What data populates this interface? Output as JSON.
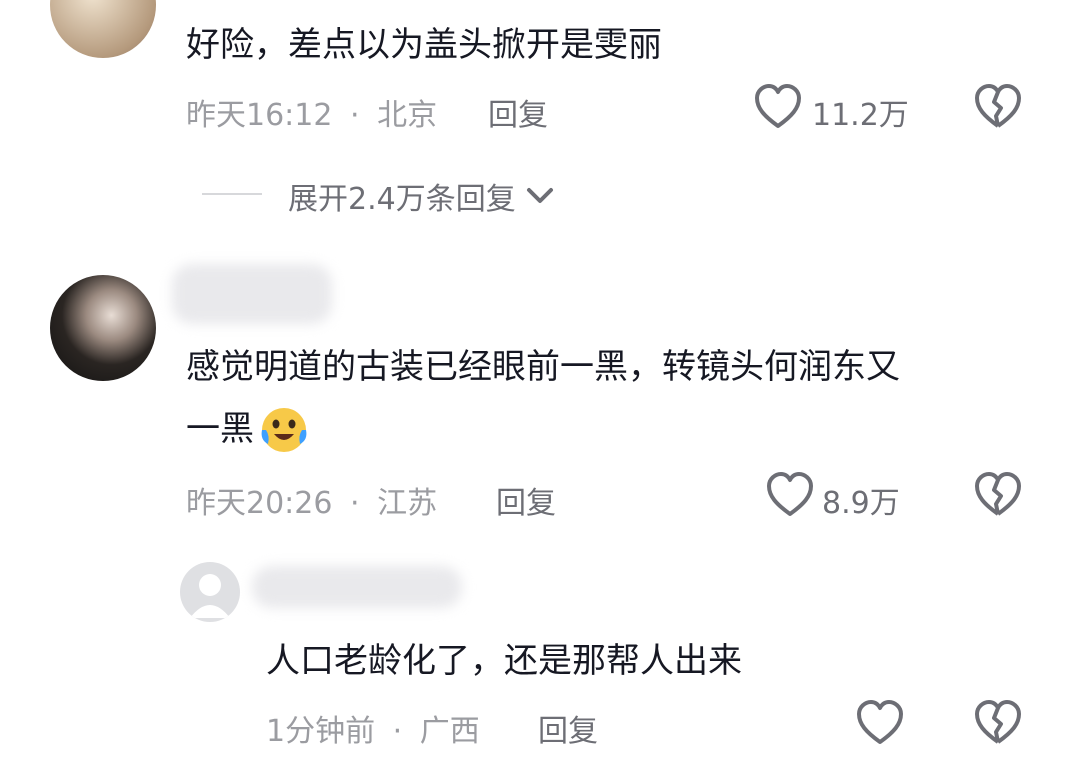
{
  "comments": [
    {
      "text": "好险，差点以为盖头掀开是雯丽",
      "time": "昨天16:12",
      "location": "北京",
      "reply_label": "回复",
      "likes": "11.2万",
      "expand_label": "展开2.4万条回复"
    },
    {
      "text_line1": "感觉明道的古装已经眼前一黑，转镜头何润东又",
      "text_line2": "一黑",
      "emoji_icon": "crying-laughing-emoji-icon",
      "time": "昨天20:26",
      "location": "江苏",
      "reply_label": "回复",
      "likes": "8.9万",
      "replies": [
        {
          "text": "人口老龄化了，还是那帮人出来",
          "time": "1分钟前",
          "location": "广西",
          "reply_label": "回复"
        }
      ]
    }
  ],
  "separator": "·",
  "icons": [
    "heart-outline-icon",
    "broken-heart-icon",
    "chevron-down-icon",
    "default-avatar-icon"
  ],
  "colors": {
    "text": "#161823",
    "meta": "#9b9ca1",
    "secondary": "#6d6e75",
    "emoji": "#f7c948"
  }
}
